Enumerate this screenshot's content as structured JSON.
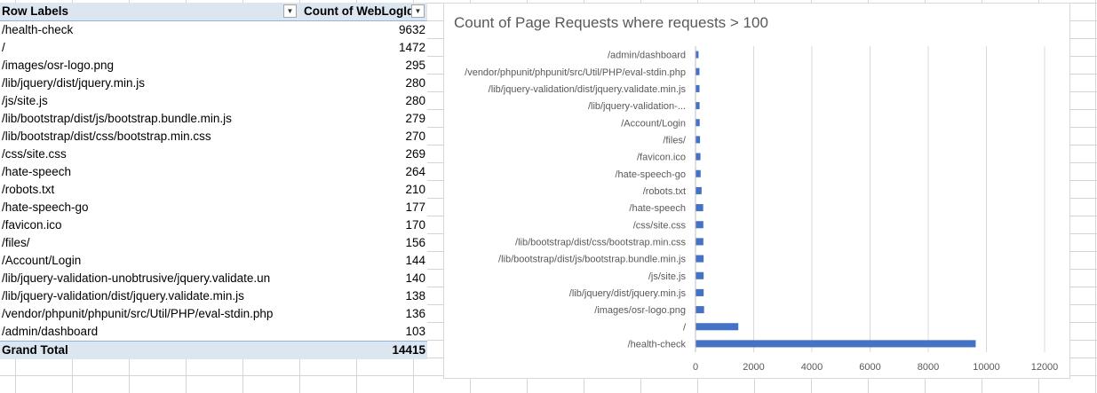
{
  "pivot": {
    "header": {
      "row_labels": "Row Labels",
      "value_header": "Count of WebLogId"
    },
    "rows": [
      {
        "label": "/health-check",
        "value": "9632"
      },
      {
        "label": "/",
        "value": "1472"
      },
      {
        "label": "/images/osr-logo.png",
        "value": "295"
      },
      {
        "label": "/lib/jquery/dist/jquery.min.js",
        "value": "280"
      },
      {
        "label": "/js/site.js",
        "value": "280"
      },
      {
        "label": "/lib/bootstrap/dist/js/bootstrap.bundle.min.js",
        "value": "279"
      },
      {
        "label": "/lib/bootstrap/dist/css/bootstrap.min.css",
        "value": "270"
      },
      {
        "label": "/css/site.css",
        "value": "269"
      },
      {
        "label": "/hate-speech",
        "value": "264"
      },
      {
        "label": "/robots.txt",
        "value": "210"
      },
      {
        "label": "/hate-speech-go",
        "value": "177"
      },
      {
        "label": "/favicon.ico",
        "value": "170"
      },
      {
        "label": "/files/",
        "value": "156"
      },
      {
        "label": "/Account/Login",
        "value": "144"
      },
      {
        "label": "/lib/jquery-validation-unobtrusive/jquery.validate.un",
        "value": "140"
      },
      {
        "label": "/lib/jquery-validation/dist/jquery.validate.min.js",
        "value": "138"
      },
      {
        "label": "/vendor/phpunit/phpunit/src/Util/PHP/eval-stdin.php",
        "value": "136"
      },
      {
        "label": "/admin/dashboard",
        "value": "103"
      }
    ],
    "total": {
      "label": "Grand Total",
      "value": "14415"
    }
  },
  "colors": {
    "bar": "#4472c4",
    "gridline": "#d9d9d9",
    "header_bg": "#dce6f1",
    "axis_text": "#595959"
  },
  "chart_data": {
    "type": "bar",
    "orientation": "horizontal",
    "title": "Count of Page Requests where requests > 100",
    "xlabel": "",
    "ylabel": "",
    "xlim": [
      0,
      12000
    ],
    "xticks": [
      0,
      2000,
      4000,
      6000,
      8000,
      10000,
      12000
    ],
    "grid": true,
    "legend": "none",
    "categories": [
      "/health-check",
      "/",
      "/images/osr-logo.png",
      "/lib/jquery/dist/jquery.min.js",
      "/js/site.js",
      "/lib/bootstrap/dist/js/bootstrap.bundle.min.js",
      "/lib/bootstrap/dist/css/bootstrap.min.css",
      "/css/site.css",
      "/hate-speech",
      "/robots.txt",
      "/hate-speech-go",
      "/favicon.ico",
      "/files/",
      "/Account/Login",
      "/lib/jquery-validation-...",
      "/lib/jquery-validation/dist/jquery.validate.min.js",
      "/vendor/phpunit/phpunit/src/Util/PHP/eval-stdin.php",
      "/admin/dashboard"
    ],
    "values": [
      9632,
      1472,
      295,
      280,
      280,
      279,
      270,
      269,
      264,
      210,
      177,
      170,
      156,
      144,
      140,
      138,
      136,
      103
    ]
  }
}
